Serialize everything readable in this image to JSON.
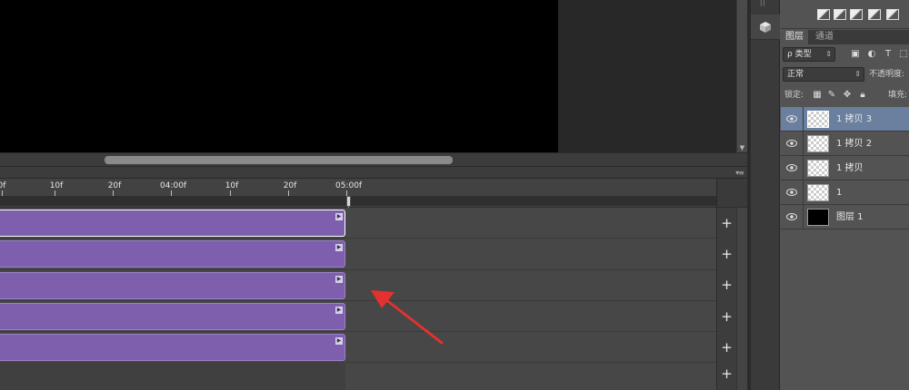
{
  "timeline": {
    "menu_icon": "panel-menu-icon",
    "ruler_labels": [
      "0f",
      "10f",
      "20f",
      "04:00f",
      "10f",
      "20f",
      "05:00f"
    ],
    "add_label": "+",
    "clip_icon": "play-triangle-icon"
  },
  "toolstrip": {
    "grip": "||",
    "cube_icon": "3d-cube-icon"
  },
  "layers_panel": {
    "tabs": [
      "图层",
      "通道"
    ],
    "filter_label": "ρ 类型",
    "blend_mode": "正常",
    "opacity_label": "不透明度:",
    "lock_label": "锁定:",
    "fill_label": "填充:",
    "layers": [
      {
        "name": "1 拷贝 3",
        "active": true,
        "thumb": "transparent"
      },
      {
        "name": "1 拷贝 2",
        "active": false,
        "thumb": "transparent"
      },
      {
        "name": "1 拷贝",
        "active": false,
        "thumb": "transparent"
      },
      {
        "name": "1",
        "active": false,
        "thumb": "transparent"
      },
      {
        "name": "图层 1",
        "active": false,
        "thumb": "black"
      }
    ]
  },
  "colors": {
    "clip": "#7e5fae",
    "selected_layer": "#6b7f9e",
    "annotation_arrow": "#e53030"
  }
}
